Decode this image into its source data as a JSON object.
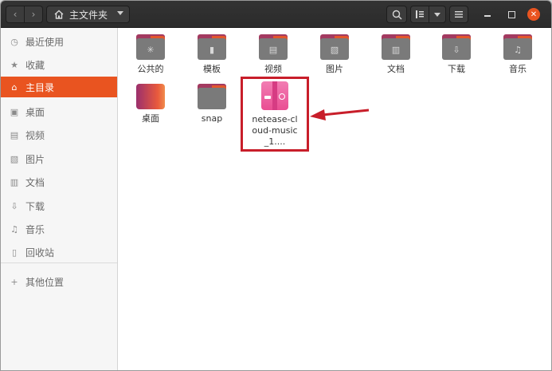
{
  "header": {
    "path_label": "主文件夹"
  },
  "sidebar": {
    "items": [
      {
        "label": "最近使用",
        "icon": "clock-icon"
      },
      {
        "label": "收藏",
        "icon": "star-icon"
      },
      {
        "label": "主目录",
        "icon": "home-icon",
        "active": true
      },
      {
        "label": "桌面",
        "icon": "desktop-icon"
      },
      {
        "label": "视频",
        "icon": "video-icon"
      },
      {
        "label": "图片",
        "icon": "image-icon"
      },
      {
        "label": "文档",
        "icon": "document-icon"
      },
      {
        "label": "下载",
        "icon": "download-icon"
      },
      {
        "label": "音乐",
        "icon": "music-icon"
      },
      {
        "label": "回收站",
        "icon": "trash-icon"
      }
    ],
    "other_locations": {
      "label": "其他位置",
      "icon": "plus-icon"
    }
  },
  "files": [
    {
      "name": "公共的",
      "type": "folder",
      "emblem": "share-icon"
    },
    {
      "name": "模板",
      "type": "folder",
      "emblem": "template-icon"
    },
    {
      "name": "视频",
      "type": "folder",
      "emblem": "video-icon"
    },
    {
      "name": "图片",
      "type": "folder",
      "emblem": "image-icon"
    },
    {
      "name": "文档",
      "type": "folder",
      "emblem": "document-icon"
    },
    {
      "name": "下载",
      "type": "folder",
      "emblem": "download-icon"
    },
    {
      "name": "音乐",
      "type": "folder",
      "emblem": "music-icon"
    },
    {
      "name": "桌面",
      "type": "desktop"
    },
    {
      "name": "snap",
      "type": "folder"
    },
    {
      "name": "netease-cloud-music_1....",
      "type": "deb-package",
      "highlighted": true
    }
  ],
  "annotation": {
    "highlight_color": "#c81e2a",
    "accent_color": "#e95420"
  }
}
